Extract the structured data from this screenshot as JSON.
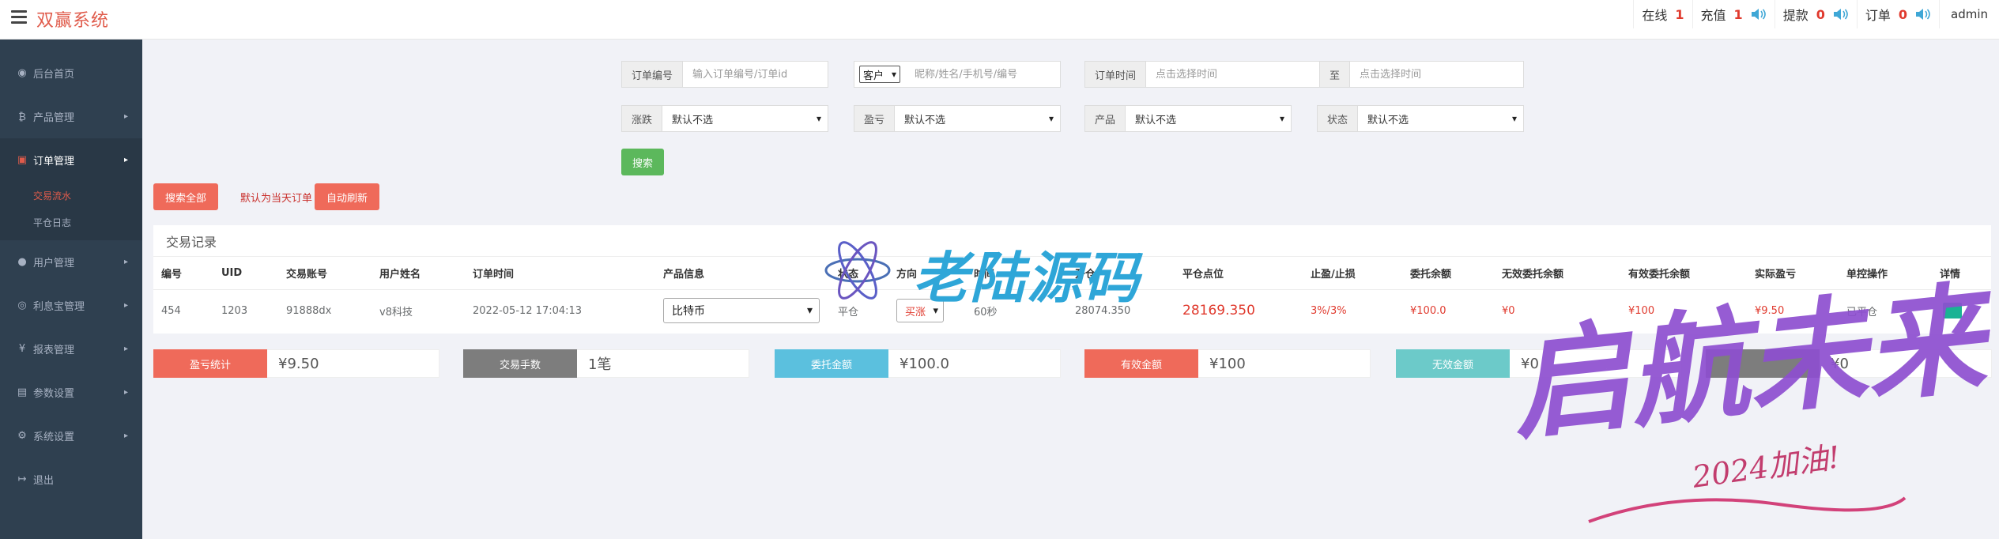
{
  "header": {
    "brand": "双赢系统",
    "stats": [
      {
        "label": "在线",
        "value": "1"
      },
      {
        "label": "充值",
        "value": "1"
      },
      {
        "label": "提款",
        "value": "0"
      },
      {
        "label": "订单",
        "value": "0"
      }
    ],
    "user": "admin"
  },
  "sidebar": {
    "items": [
      {
        "label": "后台首页",
        "icon": "dashboard-icon"
      },
      {
        "label": "产品管理",
        "icon": "bitcoin-icon"
      },
      {
        "label": "订单管理",
        "icon": "order-icon"
      },
      {
        "label": "用户管理",
        "icon": "user-icon"
      },
      {
        "label": "利息宝管理",
        "icon": "interest-icon"
      },
      {
        "label": "报表管理",
        "icon": "yen-icon"
      },
      {
        "label": "参数设置",
        "icon": "params-icon"
      },
      {
        "label": "系统设置",
        "icon": "gears-icon"
      },
      {
        "label": "退出",
        "icon": "logout-icon"
      }
    ],
    "sub": [
      "交易流水",
      "平仓日志"
    ]
  },
  "filters": {
    "order_no_label": "订单编号",
    "order_no_placeholder": "输入订单编号/订单id",
    "customer_select": "客户",
    "customer_placeholder": "昵称/姓名/手机号/编号",
    "order_time_label": "订单时间",
    "time_placeholder": "点击选择时间",
    "to_label": "至",
    "rise_fall_label": "涨跌",
    "profit_label": "盈亏",
    "product_label": "产品",
    "status_label": "状态",
    "default_option": "默认不选",
    "search_btn": "搜索",
    "search_all_btn": "搜索全部",
    "default_note": "默认为当天订单",
    "auto_refresh_btn": "自动刷新"
  },
  "table": {
    "title": "交易记录",
    "headers": [
      "编号",
      "UID",
      "交易账号",
      "用户姓名",
      "订单时间",
      "产品信息",
      "状态",
      "方向",
      "时间",
      "开仓",
      "平仓点位",
      "止盈/止损",
      "委托余额",
      "无效委托余额",
      "有效委托余额",
      "实际盈亏",
      "单控操作",
      "详情"
    ],
    "rows": [
      {
        "id": "454",
        "uid": "1203",
        "account": "91888dx",
        "name": "v8科技",
        "time": "2022-05-12 17:04:13",
        "product": "比特币",
        "status": "平仓",
        "direction": "买涨",
        "duration": "60秒",
        "open": "28074.350",
        "close": "28169.350",
        "tp_sl": "3%/3%",
        "entrust": "¥100.0",
        "invalid": "¥0",
        "valid": "¥100",
        "pnl": "¥9.50",
        "control": "已平仓"
      }
    ]
  },
  "summary": [
    {
      "label": "盈亏统计",
      "value": "¥9.50",
      "color": "#ef6a5a"
    },
    {
      "label": "交易手数",
      "value": "1笔",
      "color": "#7d7d7d"
    },
    {
      "label": "委托金额",
      "value": "¥100.0",
      "color": "#5bc0de"
    },
    {
      "label": "有效金额",
      "value": "¥100",
      "color": "#ef6a5a"
    },
    {
      "label": "无效金额",
      "value": "¥0",
      "color": "#6ccac9"
    },
    {
      "label": "",
      "value": "¥0",
      "color": "#7d7d7d"
    }
  ],
  "watermark": {
    "text1": "老陆源码",
    "text2": "启航未来",
    "text3": "2024加油!"
  }
}
